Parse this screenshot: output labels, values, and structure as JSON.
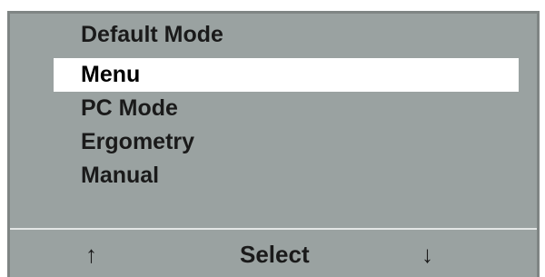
{
  "screen": {
    "title": "Default Mode",
    "menu_items": [
      {
        "label": "Menu",
        "selected": true
      },
      {
        "label": "PC Mode",
        "selected": false
      },
      {
        "label": "Ergometry",
        "selected": false
      },
      {
        "label": "Manual",
        "selected": false
      }
    ]
  },
  "softkeys": {
    "up_icon": "arrow-up-icon",
    "up_glyph": "↑",
    "select_label": "Select",
    "down_icon": "arrow-down-icon",
    "down_glyph": "↓"
  },
  "colors": {
    "screen_background": "#9aa2a1",
    "highlight_background": "#ffffff",
    "text": "#1a1a1a"
  }
}
